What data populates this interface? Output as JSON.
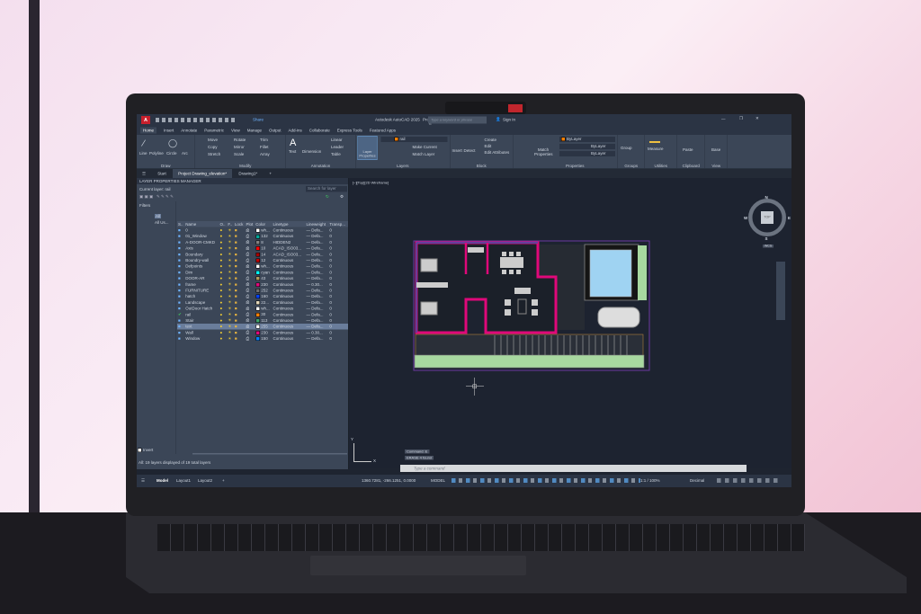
{
  "titlebar": {
    "app_title": "Autodesk AutoCAD 2025",
    "file_title": "Project Drawing_elevation.dwg",
    "share": "Share",
    "search_placeholder": "Type a keyword or phrase",
    "sign_in": "Sign In",
    "app_button": "A"
  },
  "menu": [
    "Home",
    "Insert",
    "Annotate",
    "Parametric",
    "View",
    "Manage",
    "Output",
    "Add-ins",
    "Collaborate",
    "Express Tools",
    "Featured Apps"
  ],
  "ribbon": {
    "draw": {
      "label": "Draw",
      "tools": [
        "Line",
        "Polyline",
        "Circle",
        "Arc"
      ]
    },
    "modify": {
      "label": "Modify",
      "tools": [
        "Move",
        "Rotate",
        "Trim",
        "Copy",
        "Mirror",
        "Fillet",
        "Stretch",
        "Scale",
        "Array"
      ]
    },
    "annotation": {
      "label": "Annotation",
      "tools": [
        "Text",
        "Dimension",
        "Linear",
        "Leader",
        "Table"
      ]
    },
    "layers": {
      "label": "Layers",
      "layer_properties": "Layer Properties",
      "current": "rail",
      "make_current": "Make Current",
      "match_layer": "Match Layer"
    },
    "block": {
      "label": "Block",
      "tools": [
        "Insert",
        "Detect",
        "Create",
        "Edit",
        "Edit Attributes"
      ]
    },
    "properties": {
      "label": "Properties",
      "match": "Match Properties",
      "color": "ByLayer",
      "linetype": "ByLayer",
      "lineweight": "ByLayer"
    },
    "groups": {
      "label": "Groups",
      "tool": "Group"
    },
    "utilities": {
      "label": "Utilities",
      "tool": "Measure"
    },
    "clipboard": {
      "label": "Clipboard",
      "tool": "Paste"
    },
    "view": {
      "label": "View",
      "tool": "Base"
    }
  },
  "file_tabs": [
    "Start",
    "Project Drawing_elevation*",
    "Drawing1*"
  ],
  "layer_manager": {
    "title": "LAYER PROPERTIES MANAGER",
    "current_layer": "Current layer: rail",
    "search_placeholder": "Search for layer",
    "filters_label": "Filters",
    "filter_all": "All",
    "filter_all_used": "All Us...",
    "columns": [
      "S..",
      "Name",
      "O..",
      "F..",
      "Lock",
      "Plot",
      "Color",
      "Linetype",
      "Lineweight",
      "Transp..."
    ],
    "layers": [
      {
        "name": "0",
        "color": "wh...",
        "hex": "#ffffff",
        "linetype": "Continuous",
        "lineweight": "Defa...",
        "transp": "0"
      },
      {
        "name": "01_Window",
        "color": "132",
        "hex": "#00a596",
        "linetype": "Continuous",
        "lineweight": "Defa...",
        "transp": "0"
      },
      {
        "name": "A-DOOR-CMKD",
        "color": "8",
        "hex": "#808080",
        "linetype": "HIDDEN2",
        "lineweight": "Defa...",
        "transp": "0"
      },
      {
        "name": "Axis",
        "color": "10",
        "hex": "#ff0000",
        "linetype": "ACAD_ISO03...",
        "lineweight": "Defa...",
        "transp": "0"
      },
      {
        "name": "Boundary",
        "color": "14",
        "hex": "#a50000",
        "linetype": "ACAD_ISO03...",
        "lineweight": "Defa...",
        "transp": "0"
      },
      {
        "name": "Boundry-wall",
        "color": "12",
        "hex": "#bd0000",
        "linetype": "Continuous",
        "lineweight": "Defa...",
        "transp": "0"
      },
      {
        "name": "Defpoints",
        "color": "wh...",
        "hex": "#ffffff",
        "linetype": "Continuous",
        "lineweight": "Defa...",
        "transp": "0"
      },
      {
        "name": "Dim",
        "color": "cyan",
        "hex": "#00ffff",
        "linetype": "Continuous",
        "lineweight": "Defa...",
        "transp": "0"
      },
      {
        "name": "DOOR-AR",
        "color": "43",
        "hex": "#b09a5c",
        "linetype": "Continuous",
        "lineweight": "Defa...",
        "transp": "0"
      },
      {
        "name": "frame",
        "color": "230",
        "hex": "#e0087a",
        "linetype": "Continuous",
        "lineweight": "0.30...",
        "transp": "0"
      },
      {
        "name": "FURNITURE",
        "color": "252",
        "hex": "#6e6e6e",
        "linetype": "Continuous",
        "lineweight": "Defa...",
        "transp": "0"
      },
      {
        "name": "hatch",
        "color": "160",
        "hex": "#0040ff",
        "linetype": "Continuous",
        "lineweight": "Defa...",
        "transp": "0"
      },
      {
        "name": "Landscape",
        "color": "22...",
        "hex": "#e2d6b8",
        "linetype": "Continuous",
        "lineweight": "Defa...",
        "transp": "0"
      },
      {
        "name": "OutDoor Hatch",
        "color": "wh...",
        "hex": "#ffffff",
        "linetype": "Continuous",
        "lineweight": "Defa...",
        "transp": "0"
      },
      {
        "name": "rail",
        "color": "30",
        "hex": "#ff7f00",
        "linetype": "Continuous",
        "lineweight": "Defa...",
        "transp": "0",
        "current": true
      },
      {
        "name": "Stair",
        "color": "113",
        "hex": "#3fa56b",
        "linetype": "Continuous",
        "lineweight": "Defa...",
        "transp": "0"
      },
      {
        "name": "text",
        "color": "255",
        "hex": "#ffffff",
        "linetype": "Continuous",
        "lineweight": "Defa...",
        "transp": "0",
        "selected": true
      },
      {
        "name": "Wall",
        "color": "230",
        "hex": "#e0087a",
        "linetype": "Continuous",
        "lineweight": "0.30...",
        "transp": "0"
      },
      {
        "name": "Window",
        "color": "150",
        "hex": "#0080ff",
        "linetype": "Continuous",
        "lineweight": "Defa...",
        "transp": "0"
      }
    ],
    "invert": "Invert",
    "footer": "All: 19 layers displayed of 19 total layers"
  },
  "viewport": {
    "label": "[−][Top][2D Wireframe]",
    "viewcube": {
      "top": "TOP",
      "n": "N",
      "s": "S",
      "e": "E",
      "w": "W",
      "wcs": "WCS"
    },
    "history": [
      "Command: E",
      "ERASE 4 found"
    ],
    "command_placeholder": "Type a command",
    "ucs_x": "X",
    "ucs_y": "Y"
  },
  "status": {
    "tabs": [
      "Model",
      "Layout1",
      "Layout2"
    ],
    "coords": "1360.7281, -266.1251, 0.0000",
    "model": "MODEL",
    "scale": "1:1 / 100%",
    "units": "Decimal"
  },
  "colors": {
    "wall": "#e0087a",
    "window": "#1e5fb0",
    "pool": "#9fd3f2",
    "lawn": "#a8d8a0"
  }
}
